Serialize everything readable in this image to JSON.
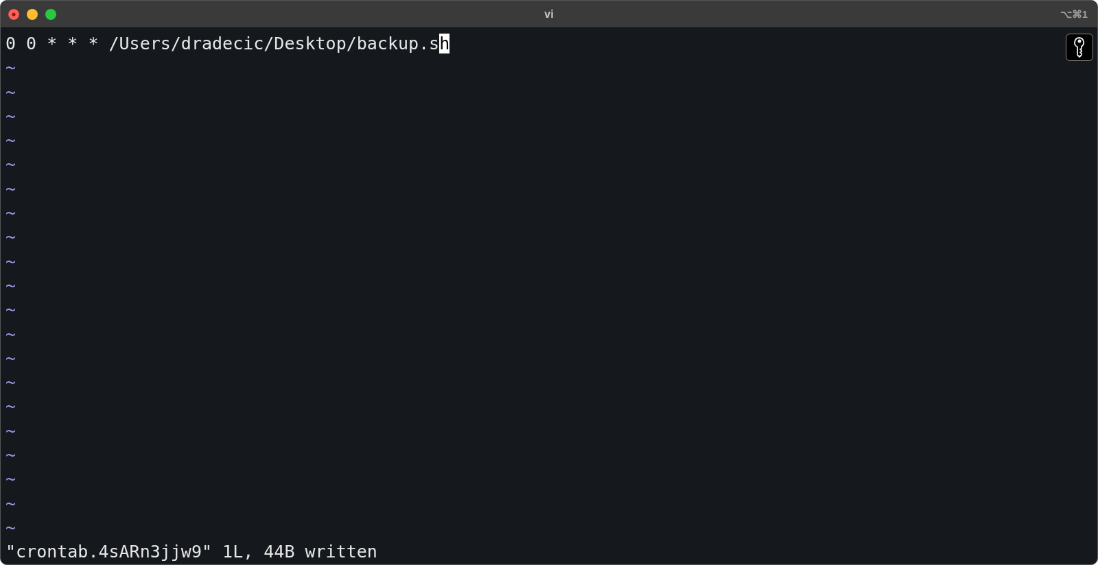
{
  "window": {
    "title": "vi",
    "shortcut": "⌥⌘1"
  },
  "editor": {
    "lines": [
      {
        "kind": "text",
        "text": "0 0 * * * /Users/dradecic/Desktop/backup.s",
        "cursor": "h"
      },
      {
        "kind": "tilde",
        "text": "~"
      },
      {
        "kind": "tilde",
        "text": "~"
      },
      {
        "kind": "tilde",
        "text": "~"
      },
      {
        "kind": "tilde",
        "text": "~"
      },
      {
        "kind": "tilde",
        "text": "~"
      },
      {
        "kind": "tilde",
        "text": "~"
      },
      {
        "kind": "tilde",
        "text": "~"
      },
      {
        "kind": "tilde",
        "text": "~"
      },
      {
        "kind": "tilde",
        "text": "~"
      },
      {
        "kind": "tilde",
        "text": "~"
      },
      {
        "kind": "tilde",
        "text": "~"
      },
      {
        "kind": "tilde",
        "text": "~"
      },
      {
        "kind": "tilde",
        "text": "~"
      },
      {
        "kind": "tilde",
        "text": "~"
      },
      {
        "kind": "tilde",
        "text": "~"
      },
      {
        "kind": "tilde",
        "text": "~"
      },
      {
        "kind": "tilde",
        "text": "~"
      },
      {
        "kind": "tilde",
        "text": "~"
      },
      {
        "kind": "tilde",
        "text": "~"
      },
      {
        "kind": "tilde",
        "text": "~"
      }
    ],
    "status_line": "\"crontab.4sARn3jjw9\" 1L, 44B written"
  }
}
